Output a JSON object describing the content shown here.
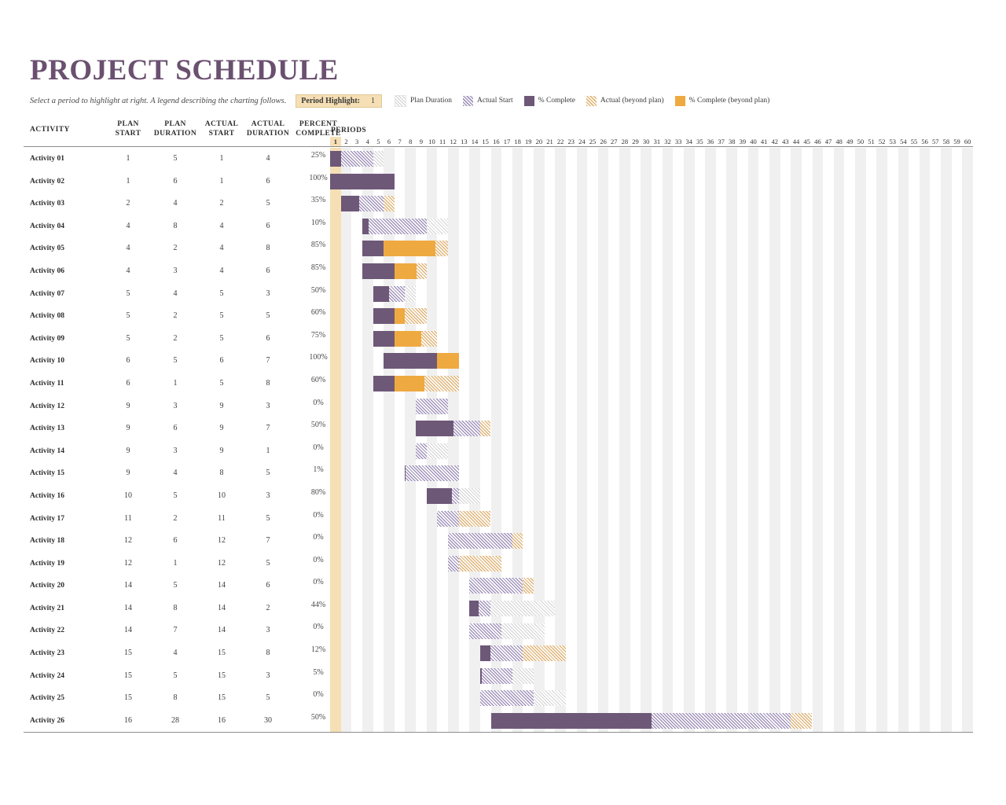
{
  "title": "PROJECT SCHEDULE",
  "subtitle": "Select a period to highlight at right.  A legend describing the charting follows.",
  "period_highlight": {
    "label": "Period Highlight:",
    "value": "1"
  },
  "legend": [
    {
      "key": "plan",
      "label": "Plan Duration"
    },
    {
      "key": "actualstart",
      "label": "Actual Start"
    },
    {
      "key": "complete",
      "label": "% Complete"
    },
    {
      "key": "beyond",
      "label": "Actual (beyond plan)"
    },
    {
      "key": "completebeyond",
      "label": "% Complete (beyond plan)"
    }
  ],
  "colors": {
    "title": "#6b5070",
    "complete": "#6e5878",
    "complete_beyond": "#efa941",
    "actual_start_hatch": "#a294bb",
    "beyond_hatch": "#e0b478",
    "plan_hatch": "#d2d2d2",
    "highlight_band": "#f6dfb4",
    "column_band": "#f0f0f0"
  },
  "table": {
    "headers": {
      "activity": "ACTIVITY",
      "plan_start": "PLAN\nSTART",
      "plan_start_l1": "PLAN",
      "plan_start_l2": "START",
      "plan_duration_l1": "PLAN",
      "plan_duration_l2": "DURATION",
      "actual_start_l1": "ACTUAL",
      "actual_start_l2": "START",
      "actual_duration_l1": "ACTUAL",
      "actual_duration_l2": "DURATION",
      "percent_complete_l1": "PERCENT",
      "percent_complete_l2": "COMPLETE",
      "periods": "PERIODS"
    }
  },
  "chart_data": {
    "type": "bar",
    "title": "PROJECT SCHEDULE",
    "subtype": "gantt",
    "xlabel": "PERIODS",
    "ylabel": "ACTIVITY",
    "xlim": [
      1,
      60
    ],
    "periods": [
      1,
      2,
      3,
      4,
      5,
      6,
      7,
      8,
      9,
      10,
      11,
      12,
      13,
      14,
      15,
      16,
      17,
      18,
      19,
      20,
      21,
      22,
      23,
      24,
      25,
      26,
      27,
      28,
      29,
      30,
      31,
      32,
      33,
      34,
      35,
      36,
      37,
      38,
      39,
      40,
      41,
      42,
      43,
      44,
      45,
      46,
      47,
      48,
      49,
      50,
      51,
      52,
      53,
      54,
      55,
      56,
      57,
      58,
      59,
      60
    ],
    "highlighted_period": 1,
    "columns": [
      "ACTIVITY",
      "PLAN START",
      "PLAN DURATION",
      "ACTUAL START",
      "ACTUAL DURATION",
      "PERCENT COMPLETE"
    ],
    "rows": [
      {
        "activity": "Activity 01",
        "plan_start": 1,
        "plan_duration": 5,
        "actual_start": 1,
        "actual_duration": 4,
        "percent_complete": "25%",
        "pct": 25
      },
      {
        "activity": "Activity 02",
        "plan_start": 1,
        "plan_duration": 6,
        "actual_start": 1,
        "actual_duration": 6,
        "percent_complete": "100%",
        "pct": 100
      },
      {
        "activity": "Activity 03",
        "plan_start": 2,
        "plan_duration": 4,
        "actual_start": 2,
        "actual_duration": 5,
        "percent_complete": "35%",
        "pct": 35
      },
      {
        "activity": "Activity 04",
        "plan_start": 4,
        "plan_duration": 8,
        "actual_start": 4,
        "actual_duration": 6,
        "percent_complete": "10%",
        "pct": 10
      },
      {
        "activity": "Activity 05",
        "plan_start": 4,
        "plan_duration": 2,
        "actual_start": 4,
        "actual_duration": 8,
        "percent_complete": "85%",
        "pct": 85
      },
      {
        "activity": "Activity 06",
        "plan_start": 4,
        "plan_duration": 3,
        "actual_start": 4,
        "actual_duration": 6,
        "percent_complete": "85%",
        "pct": 85
      },
      {
        "activity": "Activity 07",
        "plan_start": 5,
        "plan_duration": 4,
        "actual_start": 5,
        "actual_duration": 3,
        "percent_complete": "50%",
        "pct": 50
      },
      {
        "activity": "Activity 08",
        "plan_start": 5,
        "plan_duration": 2,
        "actual_start": 5,
        "actual_duration": 5,
        "percent_complete": "60%",
        "pct": 60
      },
      {
        "activity": "Activity 09",
        "plan_start": 5,
        "plan_duration": 2,
        "actual_start": 5,
        "actual_duration": 6,
        "percent_complete": "75%",
        "pct": 75
      },
      {
        "activity": "Activity 10",
        "plan_start": 6,
        "plan_duration": 5,
        "actual_start": 6,
        "actual_duration": 7,
        "percent_complete": "100%",
        "pct": 100
      },
      {
        "activity": "Activity 11",
        "plan_start": 6,
        "plan_duration": 1,
        "actual_start": 5,
        "actual_duration": 8,
        "percent_complete": "60%",
        "pct": 60
      },
      {
        "activity": "Activity 12",
        "plan_start": 9,
        "plan_duration": 3,
        "actual_start": 9,
        "actual_duration": 3,
        "percent_complete": "0%",
        "pct": 0
      },
      {
        "activity": "Activity 13",
        "plan_start": 9,
        "plan_duration": 6,
        "actual_start": 9,
        "actual_duration": 7,
        "percent_complete": "50%",
        "pct": 50
      },
      {
        "activity": "Activity 14",
        "plan_start": 9,
        "plan_duration": 3,
        "actual_start": 9,
        "actual_duration": 1,
        "percent_complete": "0%",
        "pct": 0
      },
      {
        "activity": "Activity 15",
        "plan_start": 9,
        "plan_duration": 4,
        "actual_start": 8,
        "actual_duration": 5,
        "percent_complete": "1%",
        "pct": 1
      },
      {
        "activity": "Activity 16",
        "plan_start": 10,
        "plan_duration": 5,
        "actual_start": 10,
        "actual_duration": 3,
        "percent_complete": "80%",
        "pct": 80
      },
      {
        "activity": "Activity 17",
        "plan_start": 11,
        "plan_duration": 2,
        "actual_start": 11,
        "actual_duration": 5,
        "percent_complete": "0%",
        "pct": 0
      },
      {
        "activity": "Activity 18",
        "plan_start": 12,
        "plan_duration": 6,
        "actual_start": 12,
        "actual_duration": 7,
        "percent_complete": "0%",
        "pct": 0
      },
      {
        "activity": "Activity 19",
        "plan_start": 12,
        "plan_duration": 1,
        "actual_start": 12,
        "actual_duration": 5,
        "percent_complete": "0%",
        "pct": 0
      },
      {
        "activity": "Activity 20",
        "plan_start": 14,
        "plan_duration": 5,
        "actual_start": 14,
        "actual_duration": 6,
        "percent_complete": "0%",
        "pct": 0
      },
      {
        "activity": "Activity 21",
        "plan_start": 14,
        "plan_duration": 8,
        "actual_start": 14,
        "actual_duration": 2,
        "percent_complete": "44%",
        "pct": 44
      },
      {
        "activity": "Activity 22",
        "plan_start": 14,
        "plan_duration": 7,
        "actual_start": 14,
        "actual_duration": 3,
        "percent_complete": "0%",
        "pct": 0
      },
      {
        "activity": "Activity 23",
        "plan_start": 15,
        "plan_duration": 4,
        "actual_start": 15,
        "actual_duration": 8,
        "percent_complete": "12%",
        "pct": 12
      },
      {
        "activity": "Activity 24",
        "plan_start": 15,
        "plan_duration": 5,
        "actual_start": 15,
        "actual_duration": 3,
        "percent_complete": "5%",
        "pct": 5
      },
      {
        "activity": "Activity 25",
        "plan_start": 15,
        "plan_duration": 8,
        "actual_start": 15,
        "actual_duration": 5,
        "percent_complete": "0%",
        "pct": 0
      },
      {
        "activity": "Activity 26",
        "plan_start": 16,
        "plan_duration": 28,
        "actual_start": 16,
        "actual_duration": 30,
        "percent_complete": "50%",
        "pct": 50
      }
    ]
  }
}
